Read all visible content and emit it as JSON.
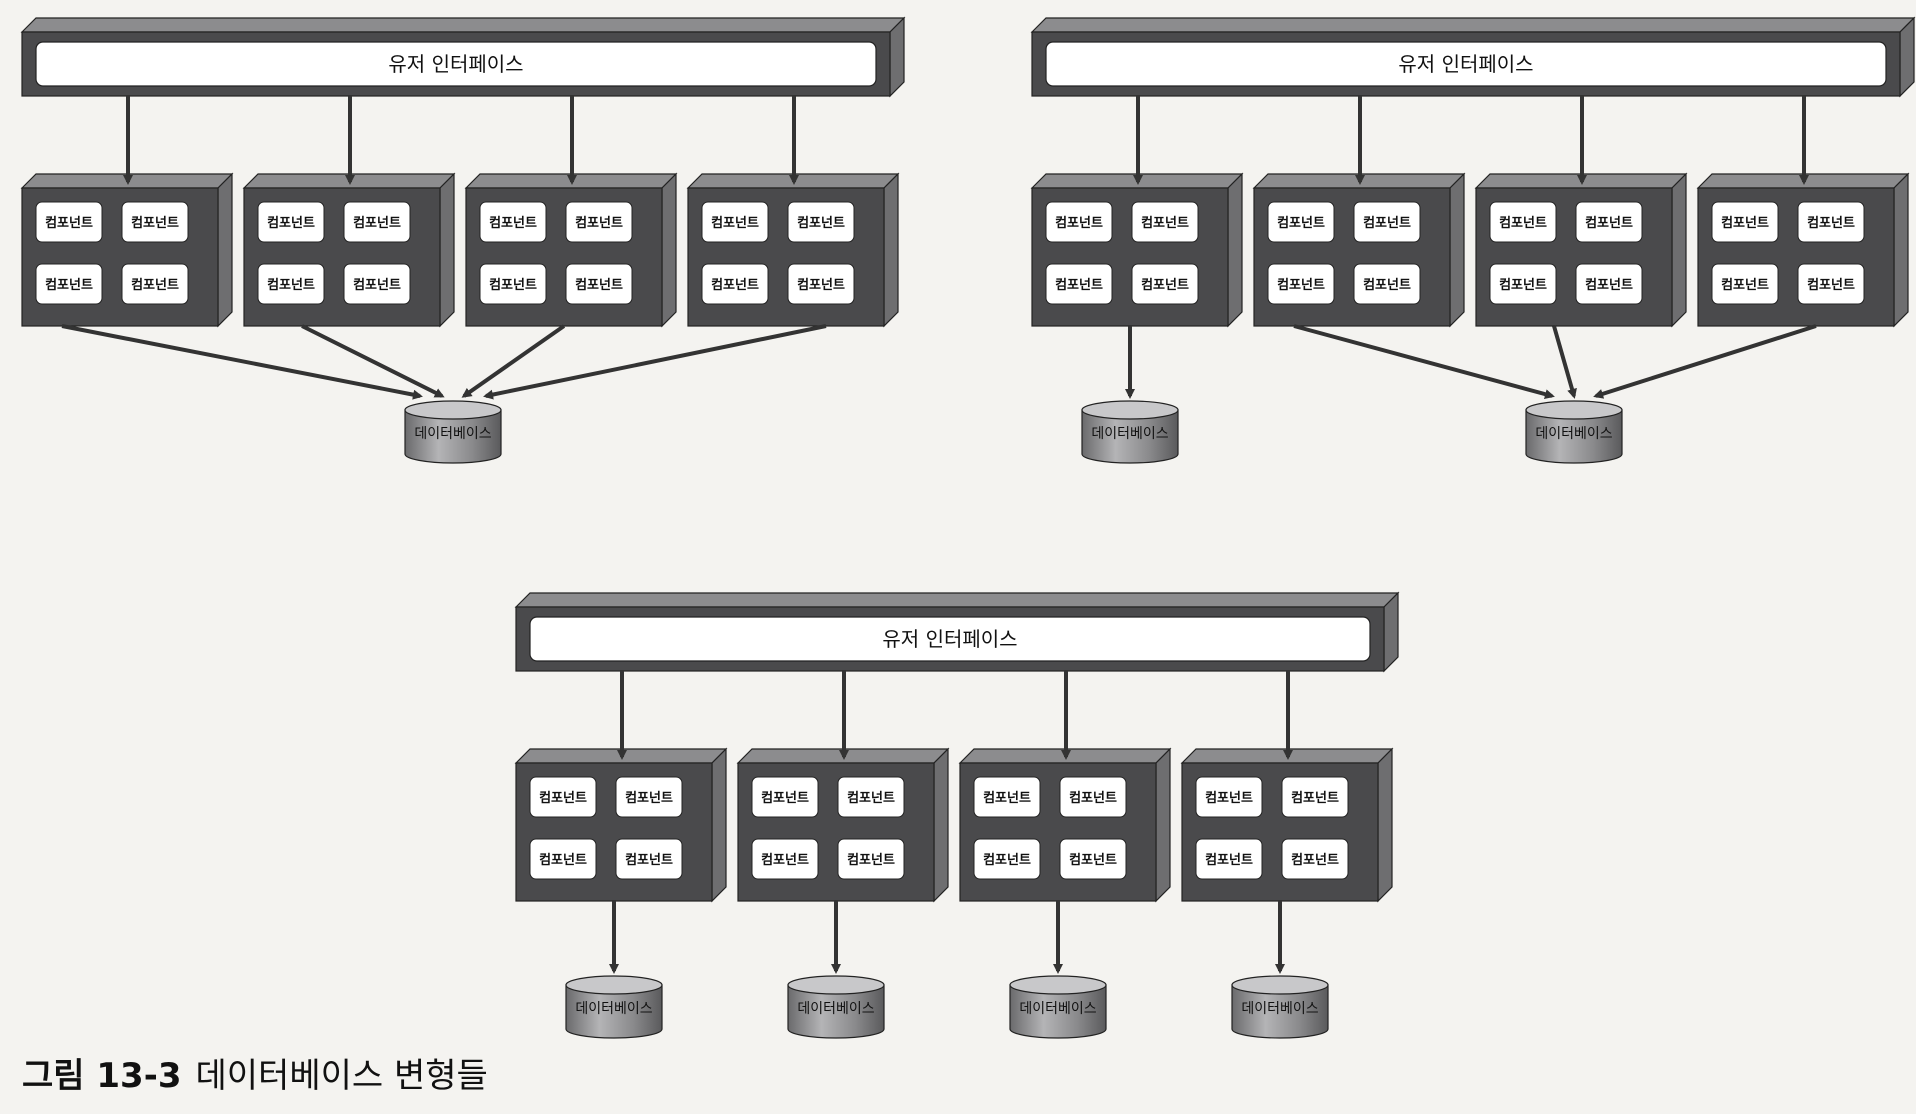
{
  "colors": {
    "frame": "#4a4a4c",
    "frame_side": "#6e6e70",
    "frame_top": "#8c8c8e",
    "inner": "#ffffff",
    "arrow": "#333333",
    "db_body": "#8a8a8c",
    "db_top": "#c8c8ca",
    "background": "#f4f3f0"
  },
  "ui_label": "유저 인터페이스",
  "component_label": "컴포넌트",
  "database_label": "데이터베이스",
  "variants": [
    {
      "name": "single-shared-database",
      "services": 4,
      "databases": [
        {
          "serves": [
            0,
            1,
            2,
            3
          ]
        }
      ]
    },
    {
      "name": "partly-shared-database",
      "services": 4,
      "databases": [
        {
          "serves": [
            0
          ]
        },
        {
          "serves": [
            1,
            2,
            3
          ]
        }
      ]
    },
    {
      "name": "database-per-service",
      "services": 4,
      "databases": [
        {
          "serves": [
            0
          ]
        },
        {
          "serves": [
            1
          ]
        },
        {
          "serves": [
            2
          ]
        },
        {
          "serves": [
            3
          ]
        }
      ]
    }
  ],
  "caption": {
    "label": "그림 13-3",
    "text": "데이터베이스 변형들"
  }
}
